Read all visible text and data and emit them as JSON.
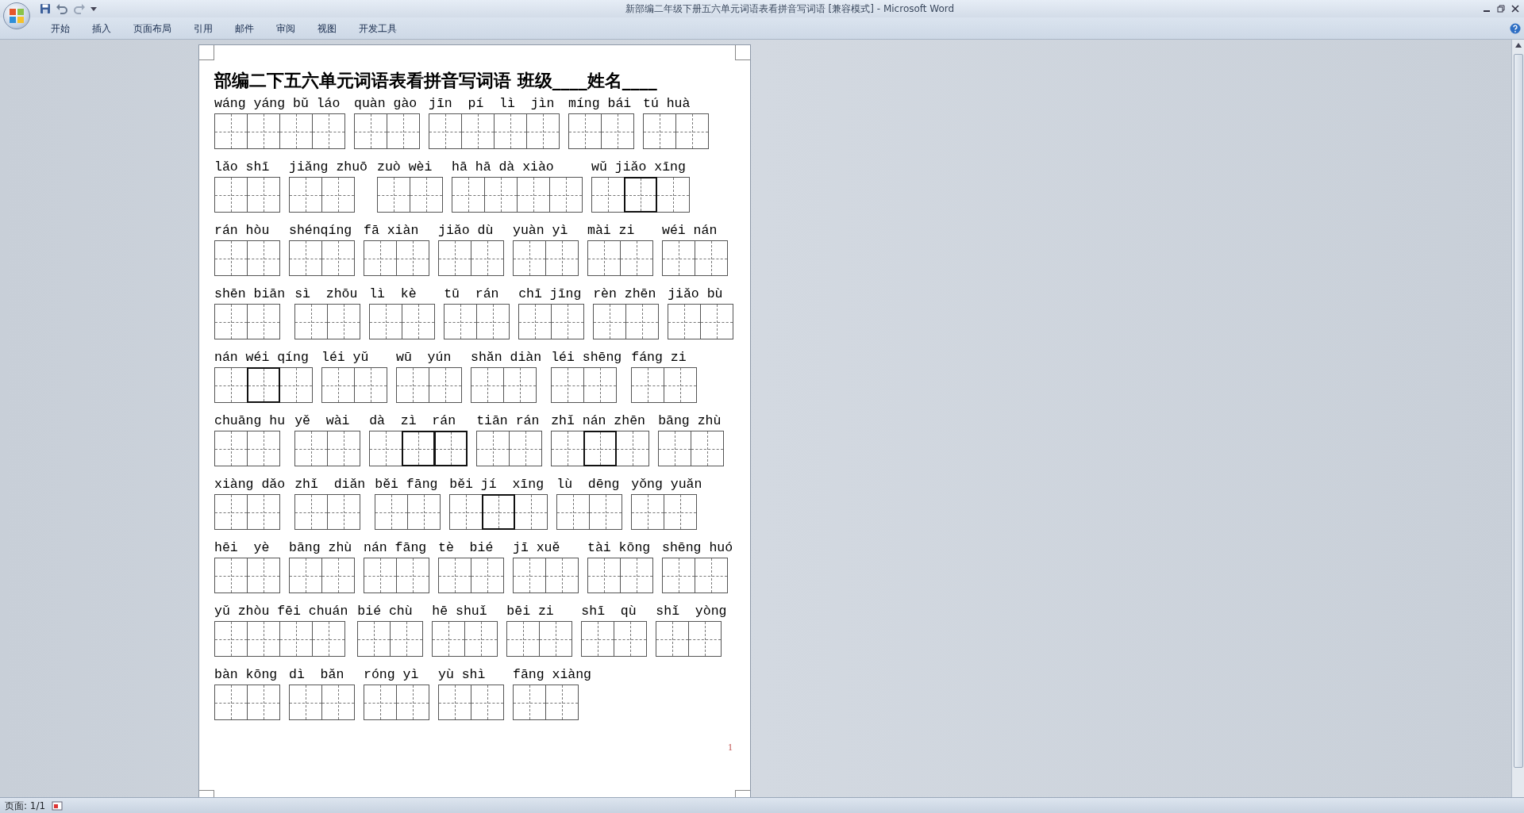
{
  "window": {
    "title": "新部编二年级下册五六单元词语表看拼音写词语 [兼容模式] - Microsoft Word"
  },
  "ribbon_tabs": [
    {
      "label": "开始",
      "selected": false
    },
    {
      "label": "插入",
      "selected": false
    },
    {
      "label": "页面布局",
      "selected": false
    },
    {
      "label": "引用",
      "selected": false
    },
    {
      "label": "邮件",
      "selected": false
    },
    {
      "label": "审阅",
      "selected": false
    },
    {
      "label": "视图",
      "selected": false
    },
    {
      "label": "开发工具",
      "selected": false
    }
  ],
  "document": {
    "title": "部编二下五六单元词语表看拼音写词语 班级____姓名____",
    "rows": [
      {
        "groups": [
          {
            "pinyin": "wáng yáng bǔ láo",
            "cells": [
              {
                "bold": false
              },
              {
                "bold": false
              },
              {
                "bold": false
              },
              {
                "bold": false
              }
            ]
          },
          {
            "pinyin": "quàn gào",
            "cells": [
              {
                "bold": false
              },
              {
                "bold": false
              }
            ]
          },
          {
            "pinyin": "jīn  pí  lì  jìn",
            "cells": [
              {
                "bold": false
              },
              {
                "bold": false
              },
              {
                "bold": false
              },
              {
                "bold": false
              }
            ]
          },
          {
            "pinyin": "míng bái",
            "cells": [
              {
                "bold": false
              },
              {
                "bold": false
              }
            ]
          },
          {
            "pinyin": "tú huà",
            "cells": [
              {
                "bold": false
              },
              {
                "bold": false
              }
            ]
          }
        ]
      },
      {
        "groups": [
          {
            "pinyin": "lǎo shī",
            "cells": [
              {
                "bold": false
              },
              {
                "bold": false
              }
            ]
          },
          {
            "pinyin": "jiǎng zhuō",
            "cells": [
              {
                "bold": false
              },
              {
                "bold": false
              }
            ]
          },
          {
            "pinyin": "zuò wèi",
            "cells": [
              {
                "bold": false
              },
              {
                "bold": false
              }
            ]
          },
          {
            "pinyin": "hā hā dà xiào",
            "cells": [
              {
                "bold": false
              },
              {
                "bold": false
              },
              {
                "bold": false
              },
              {
                "bold": false
              }
            ]
          },
          {
            "pinyin": "wǔ jiǎo xīng",
            "cells": [
              {
                "bold": false
              },
              {
                "bold": true
              },
              {
                "bold": false
              }
            ]
          }
        ]
      },
      {
        "groups": [
          {
            "pinyin": "rán hòu",
            "cells": [
              {
                "bold": false
              },
              {
                "bold": false
              }
            ]
          },
          {
            "pinyin": "shénqíng",
            "cells": [
              {
                "bold": false
              },
              {
                "bold": false
              }
            ]
          },
          {
            "pinyin": "fā xiàn",
            "cells": [
              {
                "bold": false
              },
              {
                "bold": false
              }
            ]
          },
          {
            "pinyin": "jiǎo dù",
            "cells": [
              {
                "bold": false
              },
              {
                "bold": false
              }
            ]
          },
          {
            "pinyin": "yuàn yì",
            "cells": [
              {
                "bold": false
              },
              {
                "bold": false
              }
            ]
          },
          {
            "pinyin": "mài zi",
            "cells": [
              {
                "bold": false
              },
              {
                "bold": false
              }
            ]
          },
          {
            "pinyin": "wéi nán",
            "cells": [
              {
                "bold": false
              },
              {
                "bold": false
              }
            ]
          }
        ]
      },
      {
        "groups": [
          {
            "pinyin": "shēn biān",
            "cells": [
              {
                "bold": false
              },
              {
                "bold": false
              }
            ]
          },
          {
            "pinyin": "sì  zhōu",
            "cells": [
              {
                "bold": false
              },
              {
                "bold": false
              }
            ]
          },
          {
            "pinyin": "lì  kè",
            "cells": [
              {
                "bold": false
              },
              {
                "bold": false
              }
            ]
          },
          {
            "pinyin": "tū  rán",
            "cells": [
              {
                "bold": false
              },
              {
                "bold": false
              }
            ]
          },
          {
            "pinyin": "chī jīng",
            "cells": [
              {
                "bold": false
              },
              {
                "bold": false
              }
            ]
          },
          {
            "pinyin": "rèn zhēn",
            "cells": [
              {
                "bold": false
              },
              {
                "bold": false
              }
            ]
          },
          {
            "pinyin": "jiǎo bù",
            "cells": [
              {
                "bold": false
              },
              {
                "bold": false
              }
            ]
          }
        ]
      },
      {
        "groups": [
          {
            "pinyin": "nán wéi qíng",
            "cells": [
              {
                "bold": false
              },
              {
                "bold": true
              },
              {
                "bold": false
              }
            ]
          },
          {
            "pinyin": "léi yǔ",
            "cells": [
              {
                "bold": false
              },
              {
                "bold": false
              }
            ]
          },
          {
            "pinyin": "wū  yún",
            "cells": [
              {
                "bold": false
              },
              {
                "bold": false
              }
            ]
          },
          {
            "pinyin": "shǎn diàn",
            "cells": [
              {
                "bold": false
              },
              {
                "bold": false
              }
            ]
          },
          {
            "pinyin": "léi shēng",
            "cells": [
              {
                "bold": false
              },
              {
                "bold": false
              }
            ]
          },
          {
            "pinyin": "fáng zi",
            "cells": [
              {
                "bold": false
              },
              {
                "bold": false
              }
            ]
          }
        ]
      },
      {
        "groups": [
          {
            "pinyin": "chuāng hu",
            "cells": [
              {
                "bold": false
              },
              {
                "bold": false
              }
            ]
          },
          {
            "pinyin": "yě  wài",
            "cells": [
              {
                "bold": false
              },
              {
                "bold": false
              }
            ]
          },
          {
            "pinyin": "dà  zì  rán",
            "cells": [
              {
                "bold": false
              },
              {
                "bold": true
              },
              {
                "bold": true
              }
            ]
          },
          {
            "pinyin": "tiān rán",
            "cells": [
              {
                "bold": false
              },
              {
                "bold": false
              }
            ]
          },
          {
            "pinyin": "zhǐ nán zhēn",
            "cells": [
              {
                "bold": false
              },
              {
                "bold": true
              },
              {
                "bold": false
              }
            ]
          },
          {
            "pinyin": "bāng zhù",
            "cells": [
              {
                "bold": false
              },
              {
                "bold": false
              }
            ]
          }
        ]
      },
      {
        "groups": [
          {
            "pinyin": "xiàng dǎo",
            "cells": [
              {
                "bold": false
              },
              {
                "bold": false
              }
            ]
          },
          {
            "pinyin": "zhǐ  diǎn",
            "cells": [
              {
                "bold": false
              },
              {
                "bold": false
              }
            ]
          },
          {
            "pinyin": "běi fāng",
            "cells": [
              {
                "bold": false
              },
              {
                "bold": false
              }
            ]
          },
          {
            "pinyin": "běi jí  xīng",
            "cells": [
              {
                "bold": false
              },
              {
                "bold": true
              },
              {
                "bold": false
              }
            ]
          },
          {
            "pinyin": "lù  dēng",
            "cells": [
              {
                "bold": false
              },
              {
                "bold": false
              }
            ]
          },
          {
            "pinyin": "yǒng yuǎn",
            "cells": [
              {
                "bold": false
              },
              {
                "bold": false
              }
            ]
          }
        ]
      },
      {
        "groups": [
          {
            "pinyin": "hēi  yè",
            "cells": [
              {
                "bold": false
              },
              {
                "bold": false
              }
            ]
          },
          {
            "pinyin": "bāng zhù",
            "cells": [
              {
                "bold": false
              },
              {
                "bold": false
              }
            ]
          },
          {
            "pinyin": "nán fāng",
            "cells": [
              {
                "bold": false
              },
              {
                "bold": false
              }
            ]
          },
          {
            "pinyin": "tè  bié",
            "cells": [
              {
                "bold": false
              },
              {
                "bold": false
              }
            ]
          },
          {
            "pinyin": "jī xuě",
            "cells": [
              {
                "bold": false
              },
              {
                "bold": false
              }
            ]
          },
          {
            "pinyin": "tài kōng",
            "cells": [
              {
                "bold": false
              },
              {
                "bold": false
              }
            ]
          },
          {
            "pinyin": "shēng huó",
            "cells": [
              {
                "bold": false
              },
              {
                "bold": false
              }
            ]
          }
        ]
      },
      {
        "groups": [
          {
            "pinyin": "yǔ zhòu fēi chuán",
            "cells": [
              {
                "bold": false
              },
              {
                "bold": false
              },
              {
                "bold": false
              },
              {
                "bold": false
              }
            ]
          },
          {
            "pinyin": "bié chù",
            "cells": [
              {
                "bold": false
              },
              {
                "bold": false
              }
            ]
          },
          {
            "pinyin": "hē shuǐ",
            "cells": [
              {
                "bold": false
              },
              {
                "bold": false
              }
            ]
          },
          {
            "pinyin": "bēi zi",
            "cells": [
              {
                "bold": false
              },
              {
                "bold": false
              }
            ]
          },
          {
            "pinyin": "shī  qù",
            "cells": [
              {
                "bold": false
              },
              {
                "bold": false
              }
            ]
          },
          {
            "pinyin": "shǐ  yòng",
            "cells": [
              {
                "bold": false
              },
              {
                "bold": false
              }
            ]
          }
        ]
      },
      {
        "groups": [
          {
            "pinyin": "bàn kōng",
            "cells": [
              {
                "bold": false
              },
              {
                "bold": false
              }
            ]
          },
          {
            "pinyin": "dì  bǎn",
            "cells": [
              {
                "bold": false
              },
              {
                "bold": false
              }
            ]
          },
          {
            "pinyin": "róng yì",
            "cells": [
              {
                "bold": false
              },
              {
                "bold": false
              }
            ]
          },
          {
            "pinyin": "yù shì",
            "cells": [
              {
                "bold": false
              },
              {
                "bold": false
              }
            ]
          },
          {
            "pinyin": "fāng xiàng",
            "cells": [
              {
                "bold": false
              },
              {
                "bold": false
              }
            ]
          }
        ]
      }
    ],
    "page_number": "1"
  },
  "status_bar": {
    "page": "页面: 1/1"
  }
}
